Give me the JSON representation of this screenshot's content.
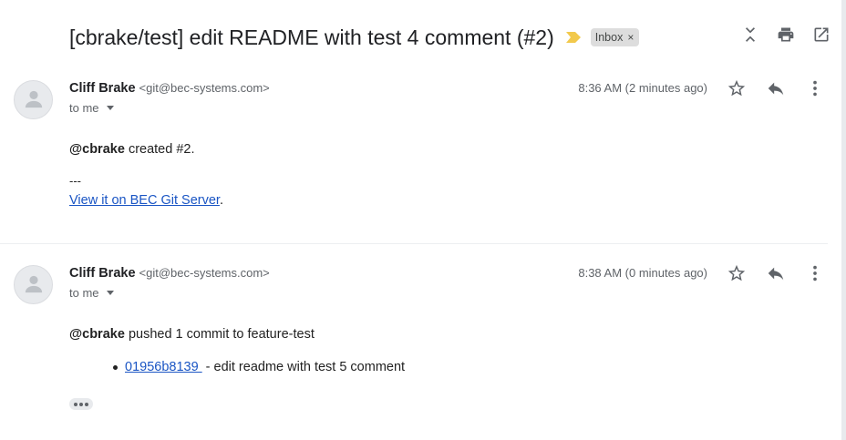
{
  "thread": {
    "subject": "[cbrake/test] edit README with test 4 comment (#2)",
    "label": "Inbox",
    "label_remove": "×",
    "importance_color": "#f2c94c"
  },
  "header_icons": [
    "collapse-all-icon",
    "print-icon",
    "open-in-new-window-icon"
  ],
  "messages": [
    {
      "sender_name": "Cliff Brake",
      "sender_email": "<git@bec-systems.com>",
      "to": "to me",
      "time": "8:36 AM (2 minutes ago)",
      "mention": "@cbrake",
      "text": "created #2.",
      "separator": "---",
      "link_text": "View it on BEC Git Server",
      "link_suffix": "."
    },
    {
      "sender_name": "Cliff Brake",
      "sender_email": "<git@bec-systems.com>",
      "to": "to me",
      "time": "8:38 AM (0 minutes ago)",
      "mention": "@cbrake",
      "text": "pushed 1 commit to feature-test",
      "commit_hash": "01956b8139 ",
      "commit_message": "- edit readme with test 5 comment"
    }
  ],
  "colors": {
    "link": "#1a55c4",
    "chip_bg": "#dddddd",
    "icon": "#5f6368"
  }
}
